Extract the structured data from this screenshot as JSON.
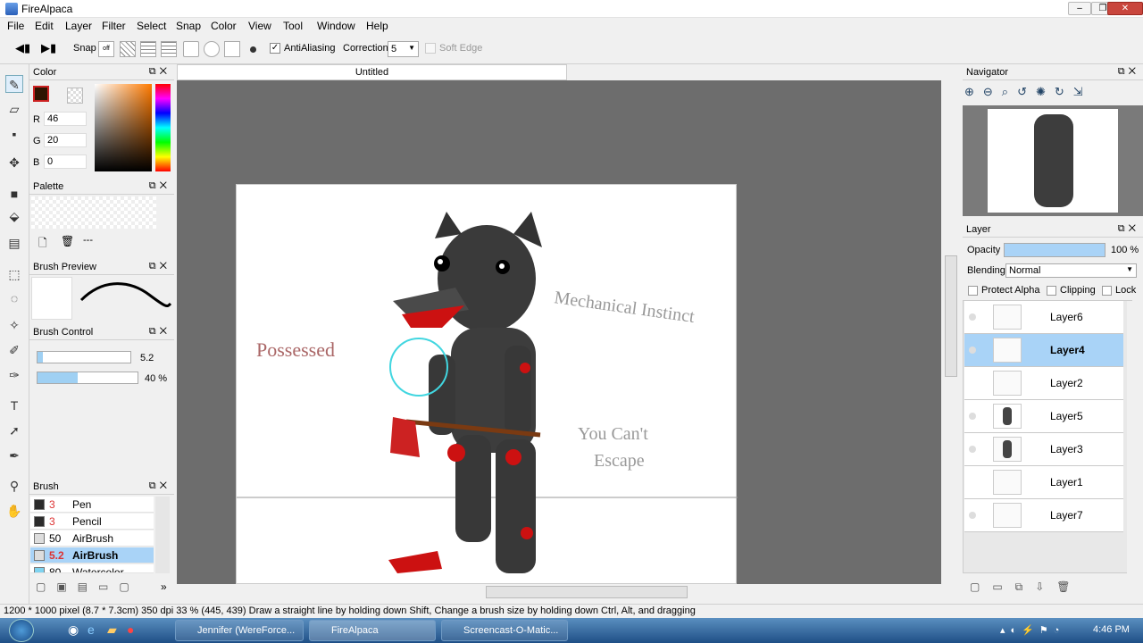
{
  "window": {
    "title": "FireAlpaca"
  },
  "menu": [
    "File",
    "Edit",
    "Layer",
    "Filter",
    "Select",
    "Snap",
    "Color",
    "View",
    "Tool",
    "Window",
    "Help"
  ],
  "toolbar": {
    "snap_label": "Snap",
    "antialiasing_label": "AntiAliasing",
    "correction_label": "Correction",
    "correction_value": "5",
    "softedge_label": "Soft Edge"
  },
  "color_panel": {
    "title": "Color",
    "r_label": "R",
    "r_value": "46",
    "g_label": "G",
    "g_value": "20",
    "b_label": "B",
    "b_value": "0",
    "fg_color": "#2e1400"
  },
  "palette_panel": {
    "title": "Palette",
    "more_label": "---"
  },
  "brush_preview_panel": {
    "title": "Brush Preview"
  },
  "brush_control_panel": {
    "title": "Brush Control",
    "size_value": "5.2",
    "opacity_value": "40 %"
  },
  "brush_panel": {
    "title": "Brush",
    "items": [
      {
        "size": "3",
        "name": "Pen",
        "swatch": "#2b2b2b"
      },
      {
        "size": "3",
        "name": "Pencil",
        "swatch": "#2b2b2b"
      },
      {
        "size": "50",
        "name": "AirBrush",
        "swatch": "#dddddd"
      },
      {
        "size": "5.2",
        "name": "AirBrush",
        "swatch": "#dddddd"
      },
      {
        "size": "80",
        "name": "Watercolor",
        "swatch": "#7fd3f0"
      }
    ]
  },
  "document": {
    "tab_title": "Untitled"
  },
  "canvas_text": {
    "possessed": "Possessed",
    "mechanical": "Mechanical Instinct",
    "you_cant": "You Can't",
    "escape": "Escape"
  },
  "navigator_panel": {
    "title": "Navigator"
  },
  "layer_panel": {
    "title": "Layer",
    "opacity_label": "Opacity",
    "opacity_value": "100 %",
    "opacity_fill": 1.0,
    "blending_label": "Blending",
    "blending_value": "Normal",
    "protect_alpha_label": "Protect Alpha",
    "clipping_label": "Clipping",
    "lock_label": "Lock",
    "layers": [
      "Layer6",
      "Layer4",
      "Layer2",
      "Layer5",
      "Layer3",
      "Layer1",
      "Layer7"
    ],
    "selected": "Layer4"
  },
  "status": {
    "size": "1200 * 1000 pixel",
    "cm": "(8.7 * 7.3cm)",
    "dpi": "350 dpi",
    "zoom": "33 %",
    "coords": "(445, 439)",
    "hint": "Draw a straight line by holding down Shift, Change a brush size by holding down Ctrl, Alt, and dragging"
  },
  "taskbar": {
    "items": [
      "Jennifer (WereForce...",
      "FireAlpaca",
      "Screencast-O-Matic..."
    ],
    "clock": "4:46 PM"
  }
}
